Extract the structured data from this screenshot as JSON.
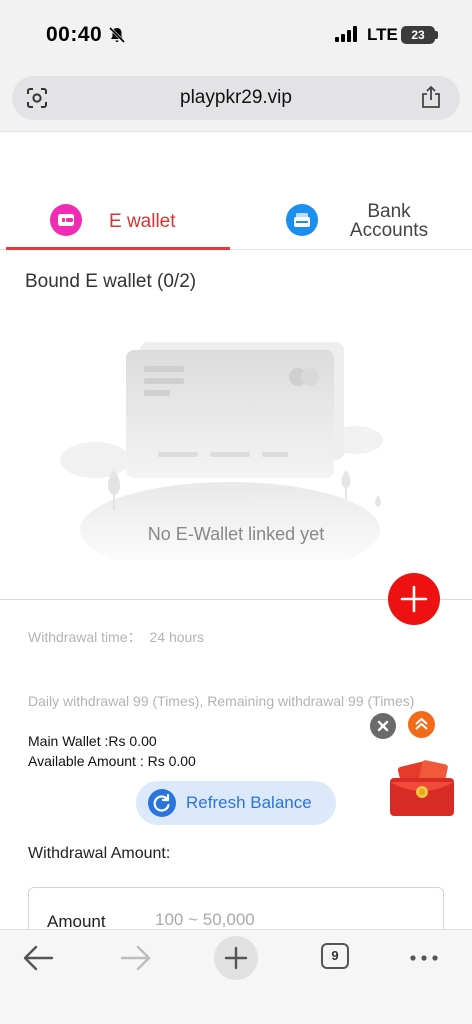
{
  "status_bar": {
    "time": "00:40",
    "network": "LTE",
    "battery": "23",
    "icons": [
      "bell-muted-icon",
      "signal-icon",
      "battery-icon"
    ]
  },
  "browser": {
    "url": "playpkr29.vip",
    "icons": [
      "lens-icon",
      "share-icon"
    ]
  },
  "tabs": [
    {
      "label": "E wallet",
      "active": true,
      "icon": "wallet-icon",
      "color": "#f12bb3"
    },
    {
      "label": "Bank\nAccounts",
      "active": false,
      "icon": "bank-card-icon",
      "color": "#1a8ff0"
    }
  ],
  "bound_title": "Bound E wallet (0/2)",
  "empty_text": "No E-Wallet linked yet",
  "add_icon": "plus-icon",
  "withdraw_info": {
    "time_label": "Withdrawal time：",
    "time_value": "24 hours",
    "daily": "Daily withdrawal 99 (Times), Remaining withdrawal 99 (Times)",
    "main_wallet": "Main Wallet :Rs 0.00",
    "available_amount": "Available Amount : Rs 0.00"
  },
  "refresh_button": {
    "label": "Refresh Balance",
    "icon": "refresh-icon"
  },
  "withdrawal_amount_label": "Withdrawal Amount:",
  "amount_field": {
    "label": "Amount",
    "placeholder": "100 ~ 50,000",
    "value": ""
  },
  "floating": {
    "close_icon": "close-icon",
    "up_icon": "chevron-up-icon",
    "gift_icon": "red-envelope-icon"
  },
  "toolbar": {
    "tabs_count": "9",
    "icons": [
      "back-arrow-icon",
      "forward-arrow-icon",
      "plus-icon",
      "tabs-icon",
      "more-icon"
    ]
  },
  "colors": {
    "accent": "#e03a3a",
    "add_button": "#ee1111",
    "refresh": "#2a74e0"
  }
}
